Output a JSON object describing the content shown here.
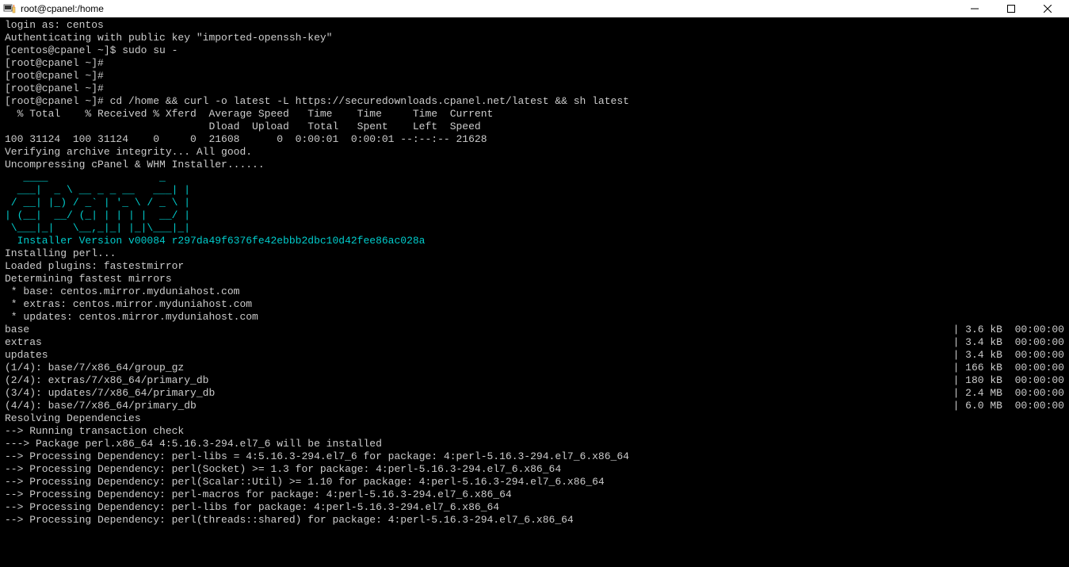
{
  "titlebar": {
    "title": "root@cpanel:/home"
  },
  "terminal": {
    "lines": [
      {
        "t": "login as: centos"
      },
      {
        "t": "Authenticating with public key \"imported-openssh-key\""
      },
      {
        "t": "[centos@cpanel ~]$ sudo su -"
      },
      {
        "t": ""
      },
      {
        "t": "[root@cpanel ~]#"
      },
      {
        "t": "[root@cpanel ~]#"
      },
      {
        "t": "[root@cpanel ~]#"
      },
      {
        "t": "[root@cpanel ~]# cd /home && curl -o latest -L https://securedownloads.cpanel.net/latest && sh latest"
      },
      {
        "t": "  % Total    % Received % Xferd  Average Speed   Time    Time     Time  Current"
      },
      {
        "t": "                                 Dload  Upload   Total   Spent    Left  Speed"
      },
      {
        "t": "100 31124  100 31124    0     0  21608      0  0:00:01  0:00:01 --:--:-- 21628"
      },
      {
        "t": "Verifying archive integrity... All good."
      },
      {
        "t": "Uncompressing cPanel & WHM Installer......"
      }
    ],
    "ascii_art": [
      "   ____                  _",
      "  ___|  _ \\ __ _ _ __   ___| |",
      " / __| |_) / _` | '_ \\ / _ \\ |",
      "| (__|  __/ (_| | | | |  __/ |",
      " \\___|_|   \\__,_|_| |_|\\___|_|"
    ],
    "installer_version": "  Installer Version v00084 r297da49f6376fe42ebbb2dbc10d42fee86ac028a",
    "post_ascii": [
      {
        "t": ""
      },
      {
        "t": "Installing perl..."
      },
      {
        "t": "Loaded plugins: fastestmirror"
      },
      {
        "t": "Determining fastest mirrors"
      },
      {
        "t": " * base: centos.mirror.myduniahost.com"
      },
      {
        "t": " * extras: centos.mirror.myduniahost.com"
      },
      {
        "t": " * updates: centos.mirror.myduniahost.com"
      }
    ],
    "repo_lines": [
      {
        "l": "base",
        "r": "| 3.6 kB  00:00:00"
      },
      {
        "l": "extras",
        "r": "| 3.4 kB  00:00:00"
      },
      {
        "l": "updates",
        "r": "| 3.4 kB  00:00:00"
      },
      {
        "l": "(1/4): base/7/x86_64/group_gz",
        "r": "| 166 kB  00:00:00"
      },
      {
        "l": "(2/4): extras/7/x86_64/primary_db",
        "r": "| 180 kB  00:00:00"
      },
      {
        "l": "(3/4): updates/7/x86_64/primary_db",
        "r": "| 2.4 MB  00:00:00"
      },
      {
        "l": "(4/4): base/7/x86_64/primary_db",
        "r": "| 6.0 MB  00:00:00"
      }
    ],
    "deps": [
      {
        "t": "Resolving Dependencies"
      },
      {
        "t": "--> Running transaction check"
      },
      {
        "t": "---> Package perl.x86_64 4:5.16.3-294.el7_6 will be installed"
      },
      {
        "t": "--> Processing Dependency: perl-libs = 4:5.16.3-294.el7_6 for package: 4:perl-5.16.3-294.el7_6.x86_64"
      },
      {
        "t": "--> Processing Dependency: perl(Socket) >= 1.3 for package: 4:perl-5.16.3-294.el7_6.x86_64"
      },
      {
        "t": "--> Processing Dependency: perl(Scalar::Util) >= 1.10 for package: 4:perl-5.16.3-294.el7_6.x86_64"
      },
      {
        "t": "--> Processing Dependency: perl-macros for package: 4:perl-5.16.3-294.el7_6.x86_64"
      },
      {
        "t": "--> Processing Dependency: perl-libs for package: 4:perl-5.16.3-294.el7_6.x86_64"
      },
      {
        "t": "--> Processing Dependency: perl(threads::shared) for package: 4:perl-5.16.3-294.el7_6.x86_64"
      }
    ]
  }
}
